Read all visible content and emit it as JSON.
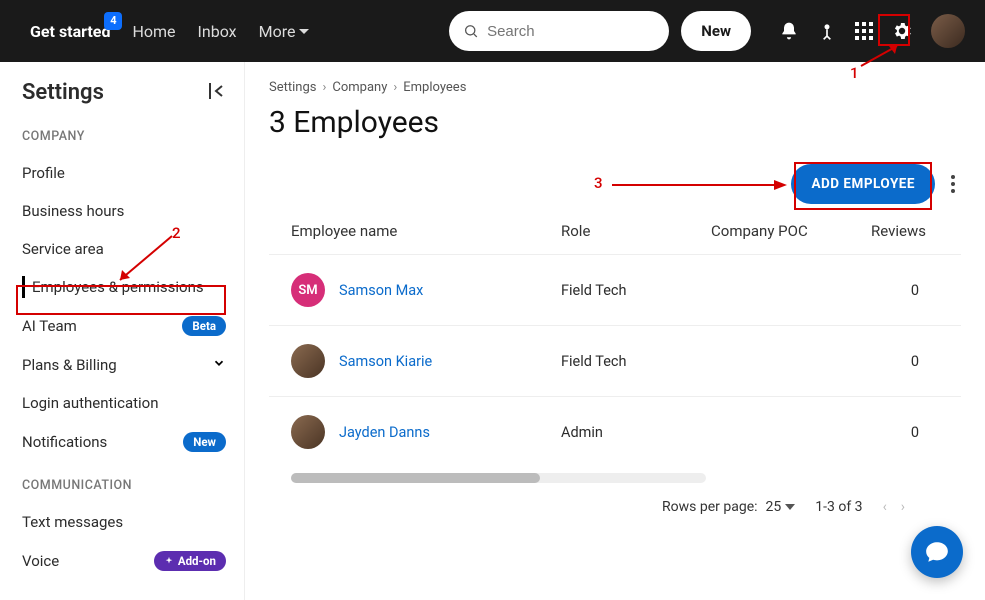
{
  "topnav": {
    "get_started": "Get started",
    "badge_count": "4",
    "home": "Home",
    "inbox": "Inbox",
    "more": "More",
    "search_placeholder": "Search",
    "new_label": "New"
  },
  "sidebar": {
    "title": "Settings",
    "sections": [
      {
        "label": "COMPANY",
        "items": [
          {
            "label": "Profile"
          },
          {
            "label": "Business hours"
          },
          {
            "label": "Service area"
          },
          {
            "label": "Employees & permissions",
            "active": true
          },
          {
            "label": "AI Team",
            "pill": "Beta"
          },
          {
            "label": "Plans & Billing",
            "expand": true
          },
          {
            "label": "Login authentication"
          },
          {
            "label": "Notifications",
            "pill": "New"
          }
        ]
      },
      {
        "label": "COMMUNICATION",
        "items": [
          {
            "label": "Text messages"
          },
          {
            "label": "Voice",
            "pill": "Add-on"
          }
        ]
      }
    ]
  },
  "breadcrumb": [
    "Settings",
    "Company",
    "Employees"
  ],
  "page_title": "3 Employees",
  "add_button": "ADD EMPLOYEE",
  "table": {
    "headers": {
      "name": "Employee name",
      "role": "Role",
      "poc": "Company POC",
      "reviews": "Reviews"
    },
    "rows": [
      {
        "initials": "SM",
        "avatar_type": "pink",
        "name": "Samson Max",
        "role": "Field Tech",
        "poc": "",
        "reviews": "0"
      },
      {
        "initials": "",
        "avatar_type": "photo",
        "name": "Samson Kiarie",
        "role": "Field Tech",
        "poc": "",
        "reviews": "0"
      },
      {
        "initials": "",
        "avatar_type": "photo",
        "name": "Jayden Danns",
        "role": "Admin",
        "poc": "",
        "reviews": "0"
      }
    ]
  },
  "pagination": {
    "rpp_label": "Rows per page:",
    "rpp_value": "25",
    "range": "1-3 of 3"
  },
  "annotations": {
    "one": "1",
    "two": "2",
    "three": "3"
  }
}
